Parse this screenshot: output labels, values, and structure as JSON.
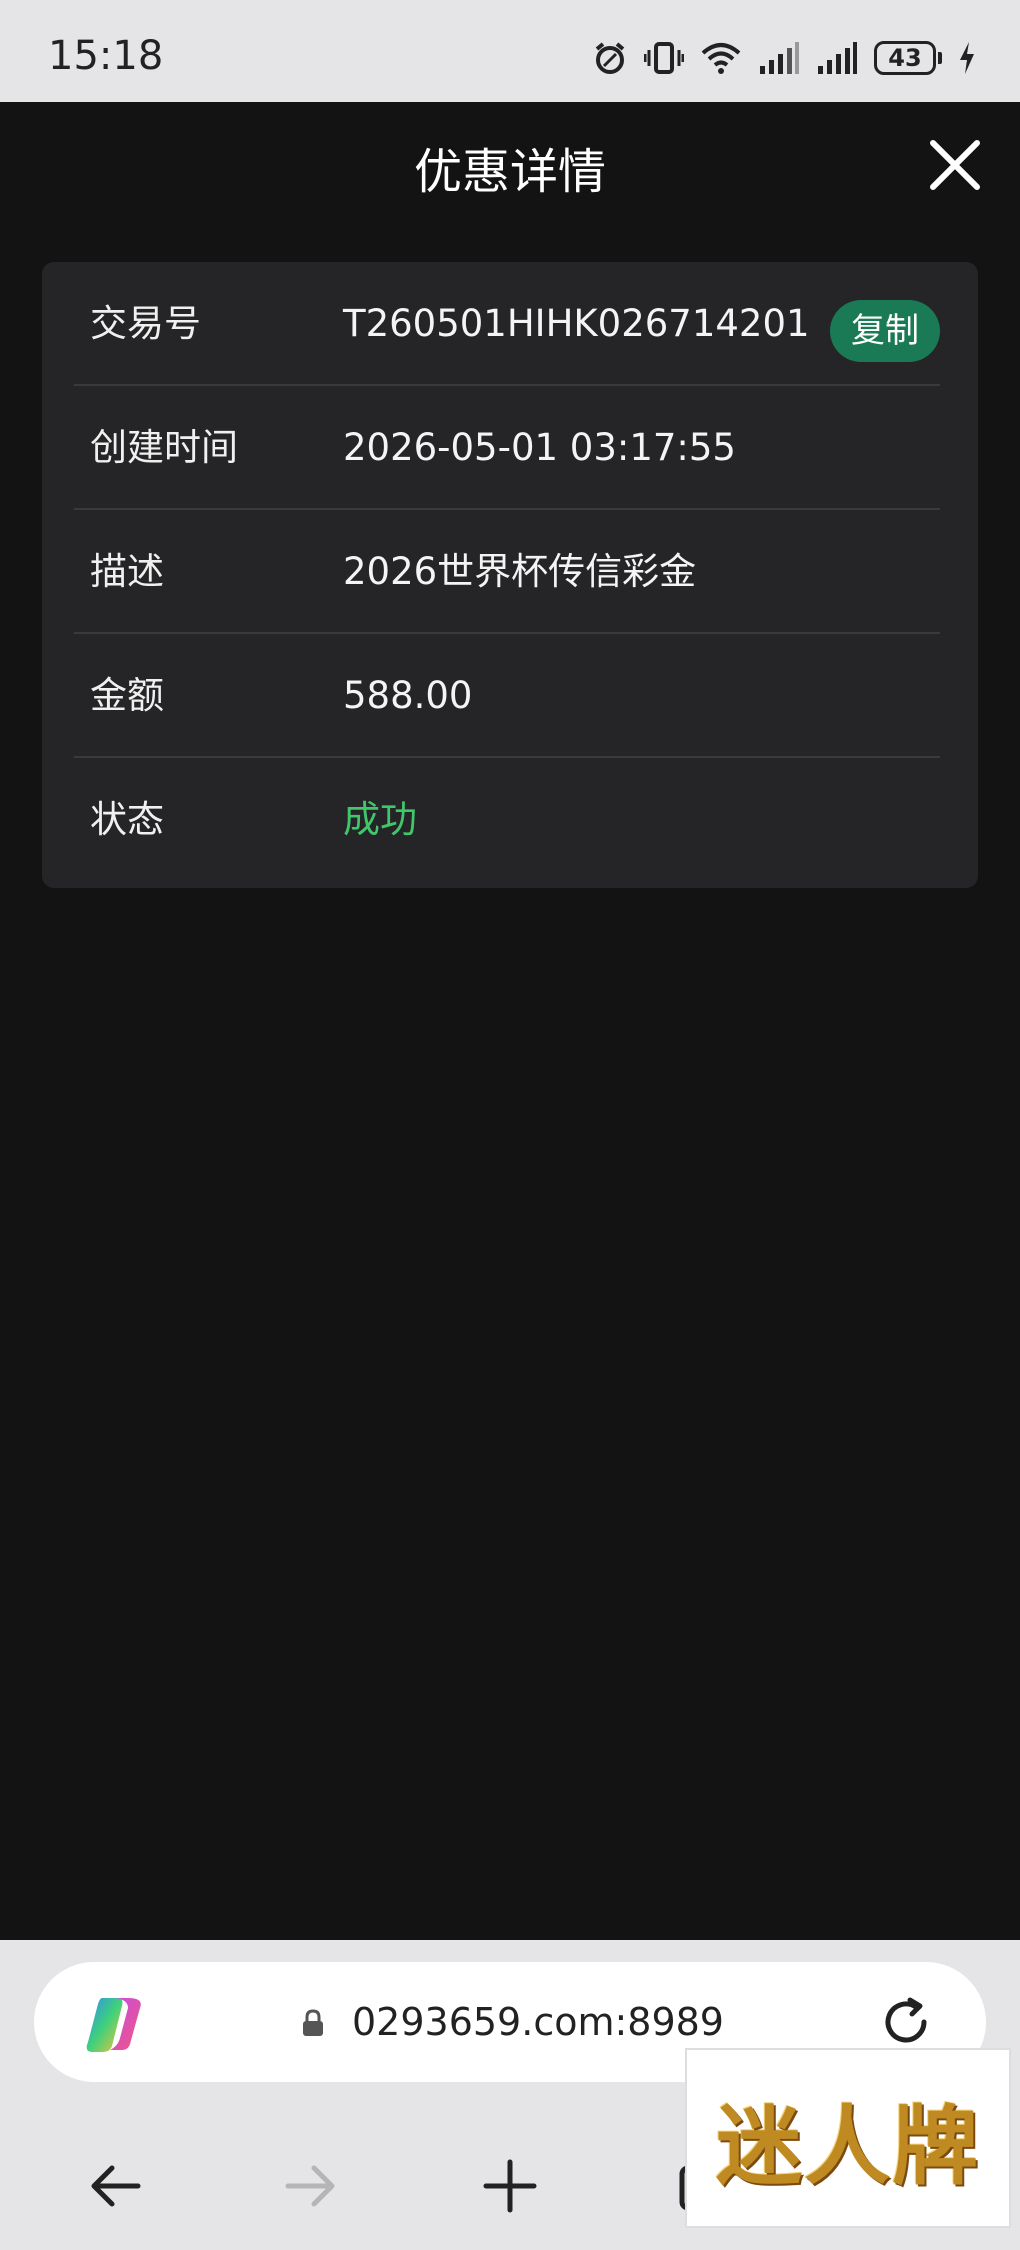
{
  "status_bar": {
    "time": "15:18",
    "battery_level": "43"
  },
  "header": {
    "title": "优惠详情"
  },
  "details": {
    "transaction_id": {
      "label": "交易号",
      "value": "T260501HIHK026714201",
      "copy_label": "复制"
    },
    "created_time": {
      "label": "创建时间",
      "value": "2026-05-01 03:17:55"
    },
    "description": {
      "label": "描述",
      "value": "2026世界杯传信彩金"
    },
    "amount": {
      "label": "金额",
      "value": "588.00"
    },
    "status": {
      "label": "状态",
      "value": "成功"
    }
  },
  "browser": {
    "url": "0293659.com:8989"
  },
  "overlay": {
    "text": "迷人牌"
  },
  "colors": {
    "background": "#141314",
    "card": "#252426",
    "success": "#3fc76b",
    "copy_button": "#1a7a55"
  }
}
